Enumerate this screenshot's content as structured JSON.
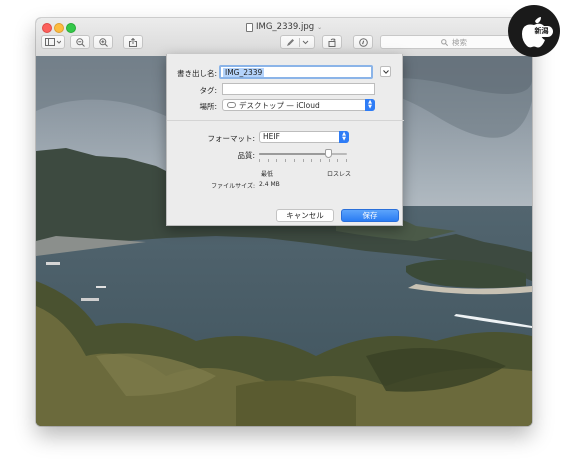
{
  "window": {
    "title": "IMG_2339.jpg",
    "title_chevron": "⌄"
  },
  "toolbar": {
    "buttons": [
      "sidebar-toggle",
      "zoom-out",
      "zoom-in",
      "share",
      "markup-pen",
      "rotate",
      "markup-toolbox"
    ],
    "search_placeholder": "検索"
  },
  "save_dialog": {
    "export_as_label": "書き出し名:",
    "export_as_value": "IMG_2339",
    "tags_label": "タグ:",
    "tags_value": "",
    "where_label": "場所:",
    "where_value": "デスクトップ — iCloud",
    "format_label": "フォーマット:",
    "format_value": "HEIF",
    "quality_label": "品質:",
    "quality_level": 0.78,
    "quality_min_label": "最低",
    "quality_max_label": "ロスレス",
    "file_size_label": "ファイルサイズ:",
    "file_size_value": "2.4 MB",
    "cancel_label": "キャンセル",
    "save_label": "保存"
  },
  "colors": {
    "accent": "#2e7cf6",
    "selection": "#b4d3fb",
    "sheet_bg": "#ececec"
  },
  "watermark": {
    "icon": "apple-logo",
    "badge_text": "新潟"
  }
}
